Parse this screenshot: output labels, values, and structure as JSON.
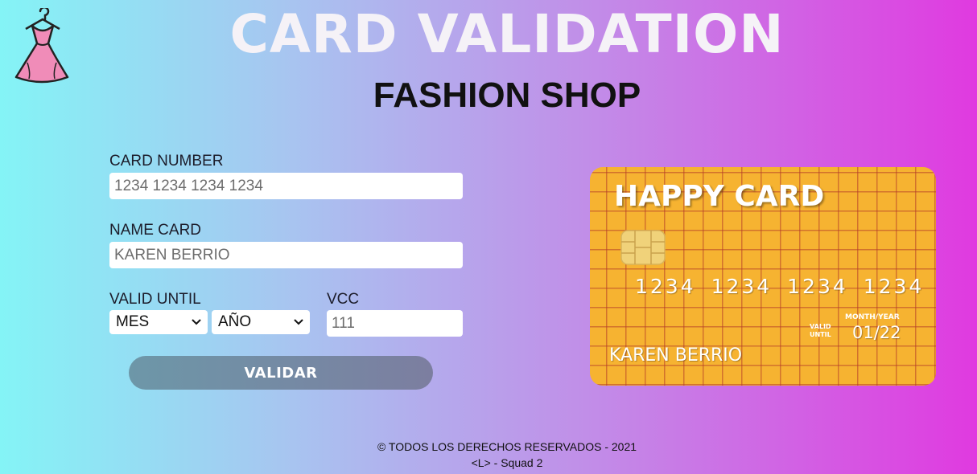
{
  "header": {
    "title": "CARD VALIDATION",
    "subtitle": "FASHION SHOP",
    "logo_icon": "dress-on-hanger-icon"
  },
  "form": {
    "card_number": {
      "label": "CARD NUMBER",
      "placeholder": "1234 1234 1234 1234"
    },
    "name_card": {
      "label": "NAME CARD",
      "value": "KAREN BERRIO"
    },
    "valid_until": {
      "label": "VALID UNTIL",
      "month": "MES",
      "year": "AÑO"
    },
    "vcc": {
      "label": "VCC",
      "placeholder": "111"
    },
    "submit_label": "VALIDAR"
  },
  "card_preview": {
    "brand": "HAPPY CARD",
    "number": "1234 1234 1234 1234",
    "valid_until_label": "VALID UNTIL",
    "month_year_label": "MONTH/YEAR",
    "expiry": "01/22",
    "holder": "KAREN BERRIO",
    "colors": {
      "card": "#f6b331",
      "grid": "#b43c28",
      "chip": "#f0d27a"
    }
  },
  "footer": {
    "copyright": "© TODOS LOS DERECHOS RESERVADOS - 2021",
    "credit": "<L> - Squad 2"
  },
  "colors": {
    "gradient_start": "#84f4f6",
    "gradient_end": "#e03ae0",
    "button_start": "#6d97a8",
    "button_end": "#7c7ea0"
  }
}
